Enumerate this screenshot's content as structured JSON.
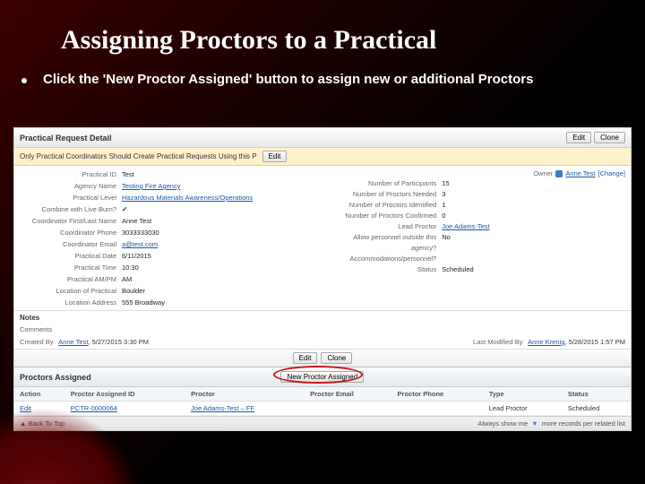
{
  "slide": {
    "title": "Assigning Proctors to a Practical",
    "bullet": "Click the 'New Proctor Assigned' button to assign new or additional Proctors"
  },
  "detail_header": {
    "title": "Practical Request Detail",
    "edit": "Edit",
    "clone": "Clone"
  },
  "notice": {
    "text": "Only Practical Coordinators Should Create Practical Requests Using this P",
    "edit": "Edit"
  },
  "owner": {
    "label": "Owner",
    "name": "Anne Test",
    "change": "[Change]"
  },
  "left_fields": [
    {
      "label": "Practical ID",
      "value": "Test"
    },
    {
      "label": "Agency Name",
      "value": "Testing Fire Agency",
      "link": true
    },
    {
      "label": "Practical Level",
      "value": "Hazardous Materials Awareness/Operations",
      "link": true
    },
    {
      "label": "Combine with Live Burn?",
      "value": "",
      "check": true
    },
    {
      "label": "Coordinator First/Last Name",
      "value": "Anne Test"
    },
    {
      "label": "Coordinator Phone",
      "value": "3033333030"
    },
    {
      "label": "Coordinator Email",
      "value": "a@test.com",
      "link": true
    },
    {
      "label": "Practical Date",
      "value": "6/11/2015"
    },
    {
      "label": "Practical Time",
      "value": "10:30"
    },
    {
      "label": "Practical AM/PM",
      "value": "AM"
    },
    {
      "label": "Location of Practical",
      "value": "Boulder"
    },
    {
      "label": "Location Address",
      "value": "555 Broadway"
    }
  ],
  "right_fields": [
    {
      "label": "Number of Participants",
      "value": "15"
    },
    {
      "label": "Number of Proctors Needed",
      "value": "3"
    },
    {
      "label": "Number of Proctors Identified",
      "value": "1"
    },
    {
      "label": "Number of Proctors Confirmed",
      "value": "0"
    },
    {
      "label": "Lead Proctor",
      "value": "Joe Adams-Test",
      "link": true
    },
    {
      "label": "Allow personnel outside this agency?",
      "value": "No"
    },
    {
      "label": "Accommodations/personnel?",
      "value": ""
    },
    {
      "label": "Status",
      "value": "Scheduled"
    }
  ],
  "notes_header": "Notes",
  "comments_label": "Comments",
  "created": {
    "label": "Created By",
    "user": "Anne Test",
    "ts": "5/27/2015 3:30 PM"
  },
  "modified": {
    "label": "Last Modified By",
    "user": "Anne Krenig",
    "ts": "5/28/2015 1:57 PM"
  },
  "buttons2": {
    "edit": "Edit",
    "clone": "Clone"
  },
  "assigned": {
    "title": "Proctors Assigned",
    "new_btn": "New Proctor Assigned",
    "cols": [
      "Action",
      "Proctor Assigned ID",
      "Proctor",
      "Proctor Email",
      "Proctor Phone",
      "Type",
      "Status"
    ],
    "row": {
      "action": "Edit",
      "id": "PCTR-0000064",
      "proctor": "Joe Adams-Test – FF",
      "email": "",
      "phone": "",
      "type": "Lead Proctor",
      "status": "Scheduled"
    }
  },
  "footer": {
    "back": "▲ Back To Top",
    "hint_a": "Always show me",
    "hint_b": "more records per related list"
  }
}
